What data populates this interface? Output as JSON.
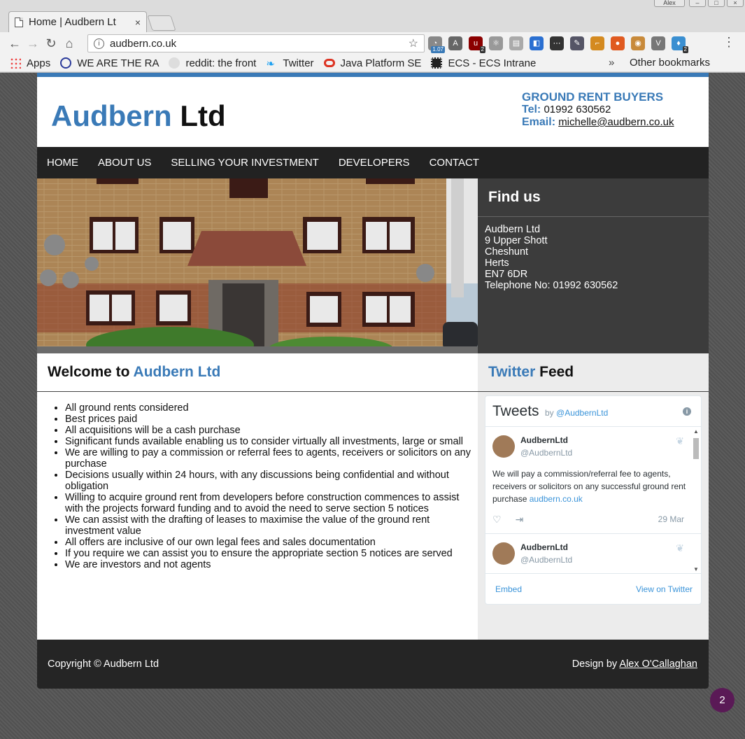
{
  "browser": {
    "tab_title": "Home | Audbern Lt",
    "tab_close": "×",
    "window_user": "Alex",
    "url": "audbern.co.uk",
    "ext_badges": [
      "1.07",
      "2",
      "2"
    ],
    "bookmarks": [
      {
        "label": "Apps"
      },
      {
        "label": "WE ARE THE RA"
      },
      {
        "label": "reddit: the front"
      },
      {
        "label": "Twitter"
      },
      {
        "label": "Java Platform SE"
      },
      {
        "label": "ECS - ECS Intrane"
      }
    ],
    "bookmarks_more": "»",
    "other_bookmarks": "Other bookmarks"
  },
  "header": {
    "logo_first": "Audbern",
    "logo_second": "Ltd",
    "contact_heading": "GROUND RENT BUYERS",
    "tel_label": "Tel:",
    "tel_value": "01992 630562",
    "email_label": "Email:",
    "email_value": "michelle@audbern.co.uk"
  },
  "nav": [
    "HOME",
    "ABOUT US",
    "SELLING YOUR INVESTMENT",
    "DEVELOPERS",
    "CONTACT"
  ],
  "findus": {
    "title": "Find us",
    "address": [
      "Audbern Ltd",
      "9 Upper Shott",
      "Cheshunt",
      "Herts",
      "EN7 6DR",
      "Telephone No: 01992 630562"
    ]
  },
  "welcome": {
    "title_prefix": "Welcome to",
    "title_brand": "Audbern Ltd",
    "items": [
      "All ground rents considered",
      "Best prices paid",
      "All acquisitions will be a cash purchase",
      "Significant funds available enabling us to consider virtually all investments, large or small",
      "We are willing to pay a commission or referral fees to agents, receivers or solicitors on any purchase",
      "Decisions usually within 24 hours, with any discussions being confidential and without obligation",
      "Willing to acquire ground rent from developers before construction commences to assist with the projects forward funding and to avoid the need to serve section 5 notices",
      "We can assist with the drafting of leases to maximise the value of the ground rent investment value",
      "All offers are inclusive of our own legal fees and sales documentation",
      "If you require we can assist you to ensure the appropriate section 5 notices are served",
      "We are investors and not agents"
    ]
  },
  "twitter": {
    "title_brand": "Twitter",
    "title_rest": "Feed",
    "widget_title": "Tweets",
    "widget_by": "by",
    "widget_handle": "@AudbernLtd",
    "tweet1": {
      "name": "AudbernLtd",
      "handle": "@AudbernLtd",
      "text": "We will pay a commission/referral fee to agents, receivers or solicitors on any successful ground rent purchase",
      "link": "audbern.co.uk",
      "date": "29 Mar"
    },
    "tweet2": {
      "name": "AudbernLtd",
      "handle": "@AudbernLtd"
    },
    "embed_label": "Embed",
    "view_label": "View on Twitter"
  },
  "footer": {
    "copyright": "Copyright © Audbern Ltd",
    "design_prefix": "Design by",
    "designer": "Alex O'Callaghan"
  },
  "notification_count": "2"
}
